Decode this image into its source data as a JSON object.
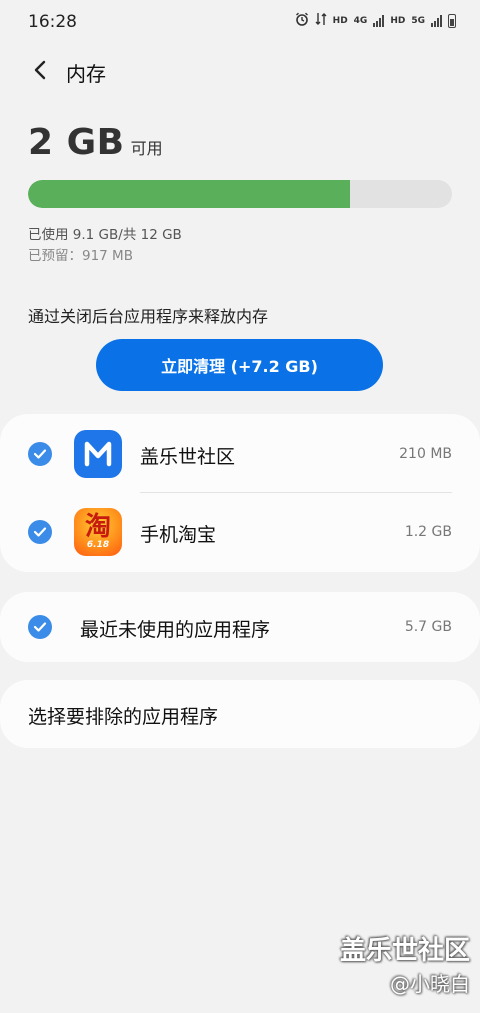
{
  "status_bar": {
    "time": "16:28",
    "icons": [
      "alarm-icon",
      "data-icon",
      "hd-label",
      "4g-signal-icon",
      "hd-label",
      "5g-signal-icon",
      "battery-icon"
    ],
    "hd1": "HD",
    "net1": "4G",
    "hd2": "HD",
    "net2": "5G"
  },
  "header": {
    "title": "内存",
    "back_icon": "back-arrow-icon"
  },
  "summary": {
    "available_value": "2 GB",
    "available_label": "可用",
    "used_text": "已使用 9.1 GB/共 12 GB",
    "reserved_text": "已预留：917 MB",
    "used_fraction": 0.76,
    "bar_color": "#5aaf5a",
    "bar_track_color": "#e2e2e2"
  },
  "hint": "通过关闭后台应用程序来释放内存",
  "clean_button": {
    "label": "立即清理 (+7.2 GB)",
    "color": "#0a72e6"
  },
  "apps": [
    {
      "name": "盖乐世社区",
      "size": "210 MB",
      "checked": true,
      "icon": "samsung-members-icon"
    },
    {
      "name": "手机淘宝",
      "size": "1.2 GB",
      "checked": true,
      "icon": "taobao-icon"
    }
  ],
  "taobao_icon_text": {
    "char": "淘",
    "num": "6.18"
  },
  "recent": {
    "label": "最近未使用的应用程序",
    "size": "5.7 GB",
    "checked": true
  },
  "exclude": {
    "label": "选择要排除的应用程序"
  },
  "watermark": {
    "title": "盖乐世社区",
    "author": "@小晓白"
  },
  "colors": {
    "check": "#3b8ce8",
    "background": "#f2f2f2",
    "card": "#fcfcfc"
  }
}
